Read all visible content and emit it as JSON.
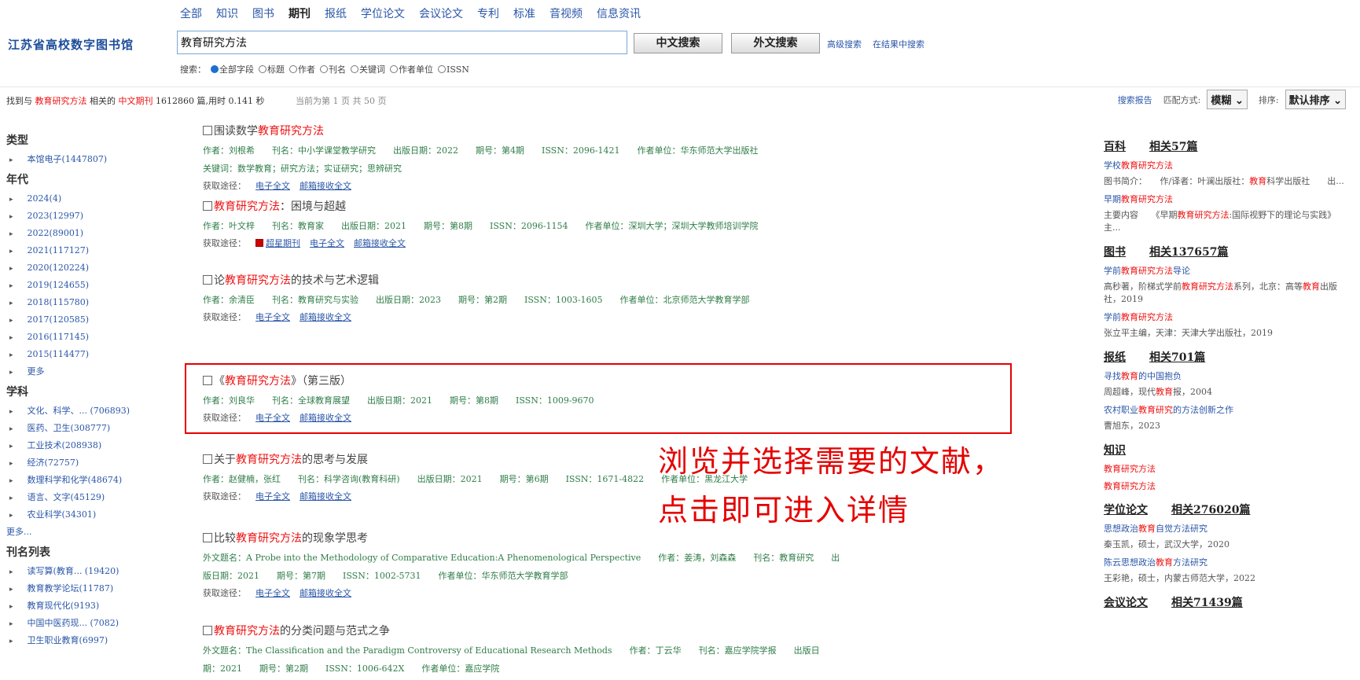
{
  "topnav": [
    "全部",
    "知识",
    "图书",
    "期刊",
    "报纸",
    "学位论文",
    "会议论文",
    "专利",
    "标准",
    "音视频",
    "信息资讯"
  ],
  "topnav_active": "期刊",
  "logo": "江苏省高校数字图书馆",
  "search": {
    "value": "教育研究方法",
    "zh_btn": "中文搜索",
    "en_btn": "外文搜索",
    "adv": "高级搜索",
    "in_results": "在结果中搜索"
  },
  "radios": {
    "prefix": "搜索：",
    "options": [
      "全部字段",
      "标题",
      "作者",
      "刊名",
      "关键词",
      "作者单位",
      "ISSN"
    ],
    "selected": "全部字段"
  },
  "status": {
    "p1": "找到与",
    "kw": "教育研究方法",
    "p2": "相关的",
    "type": "中文期刊",
    "p3": "1612860 篇,用时 0.141 秒",
    "page": "当前为第 1 页 共 50 页"
  },
  "rtools": {
    "report": "搜索报告",
    "match_label": "匹配方式:",
    "match": "模糊",
    "sort_label": "排序:",
    "sort": "默认排序"
  },
  "left": {
    "type_h": "类型",
    "type_items": [
      "本馆电子(1447807)"
    ],
    "year_h": "年代",
    "year_items": [
      "2024(4)",
      "2023(12997)",
      "2022(89001)",
      "2021(117127)",
      "2020(120224)",
      "2019(124655)",
      "2018(115780)",
      "2017(120585)",
      "2016(117145)",
      "2015(114477)",
      "更多"
    ],
    "subj_h": "学科",
    "subj_items": [
      "文化、科学、... (706893)",
      "医药、卫生(308777)",
      "工业技术(208938)",
      "经济(72757)",
      "数理科学和化学(48674)",
      "语言、文字(45129)",
      "农业科学(34301)"
    ],
    "subj_more": "更多...",
    "jour_h": "刊名列表",
    "jour_items": [
      "读写算(教育... (19420)",
      "教育教学论坛(11787)",
      "教育现代化(9193)",
      "中国中医药现... (7082)",
      "卫生职业教育(6997)"
    ]
  },
  "results": [
    {
      "pre": "围读数学",
      "hl": "教育研究方法",
      "post": "",
      "meta": "作者：刘根希　　刊名：中小学课堂教学研究　　出版日期：2022　　期号：第4期　　ISSN：2096-1421　　作者单位：华东师范大学出版社",
      "kw": "关键词：数学教育；研究方法；实证研究；思辨研究",
      "links": [
        "电子全文",
        "邮箱接收全文"
      ]
    },
    {
      "pre": "",
      "hl": "教育研究方法",
      "post": "：困境与超越",
      "meta": "作者：叶文梓　　刊名：教育家　　出版日期：2021　　期号：第8期　　ISSN：2096-1154　　作者单位：深圳大学；深圳大学教师培训学院",
      "kw": "",
      "links": [
        "超星期刊",
        "电子全文",
        "邮箱接收全文"
      ]
    },
    {
      "pre": "论",
      "hl": "教育研究方法",
      "post": "的技术与艺术逻辑",
      "meta": "作者：余清臣　　刊名：教育研究与实验　　出版日期：2023　　期号：第2期　　ISSN：1003-1605　　作者单位：北京师范大学教育学部",
      "kw": "",
      "links": [
        "电子全文",
        "邮箱接收全文"
      ]
    },
    {
      "pre": "《",
      "hl": "教育研究方法",
      "post": "》（第三版）",
      "meta": "作者：刘良华　　刊名：全球教育展望　　出版日期：2021　　期号：第8期　　ISSN：1009-9670",
      "kw": "",
      "links": [
        "电子全文",
        "邮箱接收全文"
      ]
    },
    {
      "pre": "关于",
      "hl": "教育研究方法",
      "post": "的思考与发展",
      "meta": "作者：赵健楠，张红　　刊名：科学咨询(教育科研)　　出版日期：2021　　期号：第6期　　ISSN：1671-4822　　作者单位：黑龙江大学",
      "kw": "",
      "links": [
        "电子全文",
        "邮箱接收全文"
      ]
    },
    {
      "pre": "比较",
      "hl": "教育研究方法",
      "post": "的现象学思考",
      "meta": "外文题名：A Probe into the Methodology of Comparative Education:A Phenomenological Perspective　　作者：姜涛，刘森森　　刊名：教育研究　　出",
      "kw": "版日期：2021　　期号：第7期　　ISSN：1002-5731　　作者单位：华东师范大学教育学部",
      "links": [
        "电子全文",
        "邮箱接收全文"
      ]
    },
    {
      "pre": "",
      "hl": "教育研究方法",
      "post": "的分类问题与范式之争",
      "meta": "外文题名：The Classification and the Paradigm Controversy of Educational Research Methods　　作者：丁云华　　刊名：嘉应学院学报　　出版日",
      "kw": "期：2021　　期号：第2期　　ISSN：1006-642X　　作者单位：嘉应学院",
      "links": []
    }
  ],
  "get_label": "获取途径：",
  "annotation": {
    "line1": "浏览并选择需要的文献，",
    "line2": "点击即可进入详情"
  },
  "right": {
    "baike_h": "百科",
    "baike_cnt": "相关57篇",
    "baike": [
      {
        "title": "学校教育研究方法",
        "desc": "图书简介：　　作/译者：叶澜出版社：教育科学出版社　　出..."
      },
      {
        "title": "早期教育研究方法",
        "desc": "主要内容　　《早期教育研究方法:国际视野下的理论与实践》主..."
      }
    ],
    "book_h": "图书",
    "book_cnt": "相关137657篇",
    "books": [
      {
        "title": "学前教育研究方法导论",
        "desc": "高秒著，阶梯式学前教育研究方法系列，北京：高等教育出版社，2019"
      },
      {
        "title": "学前教育研究方法",
        "desc": "张立平主编，天津：天津大学出版社，2019"
      }
    ],
    "news_h": "报纸",
    "news_cnt": "相关701篇",
    "news": [
      {
        "title": "寻找教育的中国抱负",
        "desc": "周超峰，现代教育报，2004"
      },
      {
        "title": "农村职业教育研究的方法创新之作",
        "desc": "曹旭东，2023"
      }
    ],
    "know_h": "知识",
    "know": [
      "教育研究方法",
      "教育研究方法"
    ],
    "thesis_h": "学位论文",
    "thesis_cnt": "相关276020篇",
    "thesis": [
      {
        "title": "思想政治教育自觉方法研究",
        "desc": "秦玉凯，硕士，武汉大学，2020"
      },
      {
        "title": "陈云思想政治教育方法研究",
        "desc": "王彩艳，硕士，内蒙古师范大学，2022"
      }
    ],
    "conf_h": "会议论文",
    "conf_cnt": "相关71439篇"
  }
}
